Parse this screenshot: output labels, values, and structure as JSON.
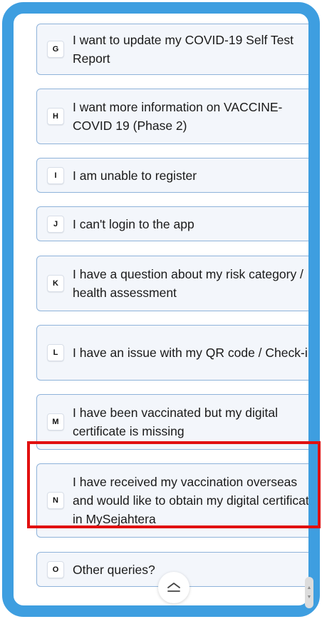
{
  "options": [
    {
      "letter": "G",
      "text": "I want to update my COVID-19 Self Test Report"
    },
    {
      "letter": "H",
      "text": "I want more information on VACCINE-COVID 19 (Phase 2)"
    },
    {
      "letter": "I",
      "text": "I am unable to register"
    },
    {
      "letter": "J",
      "text": "I can't login to the app"
    },
    {
      "letter": "K",
      "text": "I have a question about my risk category / health assessment"
    },
    {
      "letter": "L",
      "text": "I have an issue with my QR code / Check-in"
    },
    {
      "letter": "M",
      "text": "I have been vaccinated but my digital certificate is missing"
    },
    {
      "letter": "N",
      "text": "I have received my vaccination overseas and would like to obtain my digital certificate in MySejahtera"
    },
    {
      "letter": "O",
      "text": "Other queries?"
    }
  ],
  "highlight_color": "#e11010",
  "frame_color": "#3e9ee0",
  "scroll_top_icon": "chevron-up-double-icon",
  "scroll_handle_icon": "scroll-handle-icon"
}
